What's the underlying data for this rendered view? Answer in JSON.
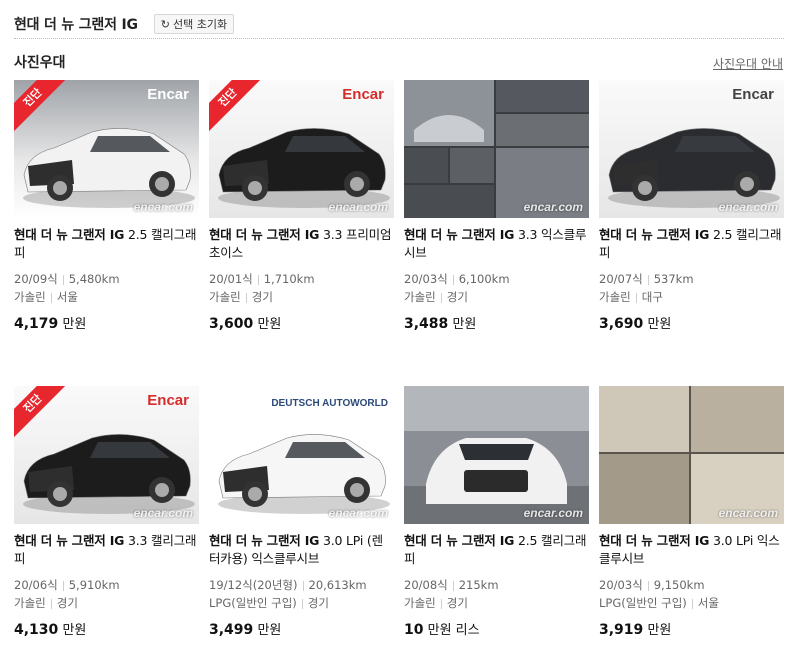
{
  "header": {
    "title": "현대 더 뉴 그랜저 IG",
    "reset_label": "선택 초기화"
  },
  "section": {
    "title": "사진우대",
    "guide_label": "사진우대 안내"
  },
  "listings": [
    {
      "model": "현대 더 뉴 그랜저 IG",
      "trim": " 2.5 캘리그래피",
      "year": "20/09식",
      "mileage": "5,480km",
      "fuel": "가솔린",
      "region": "서울",
      "price": "4,179",
      "unit": "만원",
      "badge": "진단",
      "brand_text": "Encar",
      "watermark": "encar.com",
      "photo": "white"
    },
    {
      "model": "현대 더 뉴 그랜저 IG",
      "trim": " 3.3 프리미엄 초이스",
      "year": "20/01식",
      "mileage": "1,710km",
      "fuel": "가솔린",
      "region": "경기",
      "price": "3,600",
      "unit": "만원",
      "badge": "진단",
      "brand_text": "Encar",
      "watermark": "encar.com",
      "photo": "black"
    },
    {
      "model": "현대 더 뉴 그랜저 IG",
      "trim": " 3.3 익스클루시브",
      "year": "20/03식",
      "mileage": "6,100km",
      "fuel": "가솔린",
      "region": "경기",
      "price": "3,488",
      "unit": "만원",
      "badge": "",
      "brand_text": "",
      "watermark": "encar.com",
      "photo": "collage"
    },
    {
      "model": "현대 더 뉴 그랜저 IG",
      "trim": " 2.5 캘리그래피",
      "year": "20/07식",
      "mileage": "537km",
      "fuel": "가솔린",
      "region": "대구",
      "price": "3,690",
      "unit": "만원",
      "badge": "",
      "brand_text": "Encar",
      "watermark": "encar.com",
      "photo": "dark"
    },
    {
      "model": "현대 더 뉴 그랜저 IG",
      "trim": " 3.3 캘리그래피",
      "year": "20/06식",
      "mileage": "5,910km",
      "fuel": "가솔린",
      "region": "경기",
      "price": "4,130",
      "unit": "만원",
      "badge": "진단",
      "brand_text": "Encar",
      "watermark": "encar.com",
      "photo": "black"
    },
    {
      "model": "현대 더 뉴 그랜저 IG",
      "trim": " 3.0 LPi (렌터카용) 익스클루시브",
      "year": "19/12식(20년형)",
      "mileage": "20,613km",
      "fuel": "LPG(일반인 구입)",
      "region": "경기",
      "price": "3,499",
      "unit": "만원",
      "badge": "",
      "brand_text": "DEUTSCH AUTOWORLD",
      "watermark": "encar.com",
      "photo": "white2"
    },
    {
      "model": "현대 더 뉴 그랜저 IG",
      "trim": " 2.5 캘리그래피",
      "year": "20/08식",
      "mileage": "215km",
      "fuel": "가솔린",
      "region": "경기",
      "price": "10",
      "unit": "만원 리스",
      "badge": "",
      "brand_text": "",
      "watermark": "encar.com",
      "photo": "street"
    },
    {
      "model": "현대 더 뉴 그랜저 IG",
      "trim": " 3.0 LPi 익스클루시브",
      "year": "20/03식",
      "mileage": "9,150km",
      "fuel": "LPG(일반인 구입)",
      "region": "서울",
      "price": "3,919",
      "unit": "만원",
      "badge": "",
      "brand_text": "",
      "watermark": "encar.com",
      "photo": "interior"
    }
  ]
}
